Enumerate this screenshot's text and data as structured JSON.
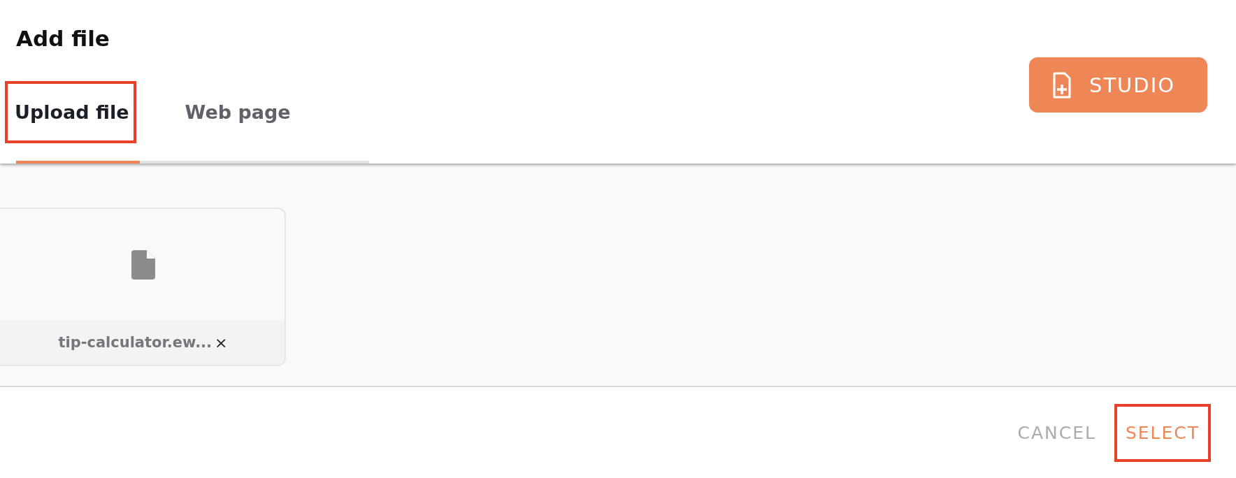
{
  "title": "Add file",
  "tabs": [
    {
      "label": "Upload file",
      "selected": true,
      "highlighted": true
    },
    {
      "label": "Web page",
      "selected": false,
      "highlighted": false
    }
  ],
  "studio_button": {
    "label": "STUDIO"
  },
  "files": [
    {
      "name": "tip-calculator.ew...",
      "remove": "×"
    }
  ],
  "buttons": [
    {
      "label": "CANCEL",
      "kind": "secondary",
      "highlighted": false
    },
    {
      "label": "SELECT",
      "kind": "primary",
      "highlighted": true
    }
  ]
}
